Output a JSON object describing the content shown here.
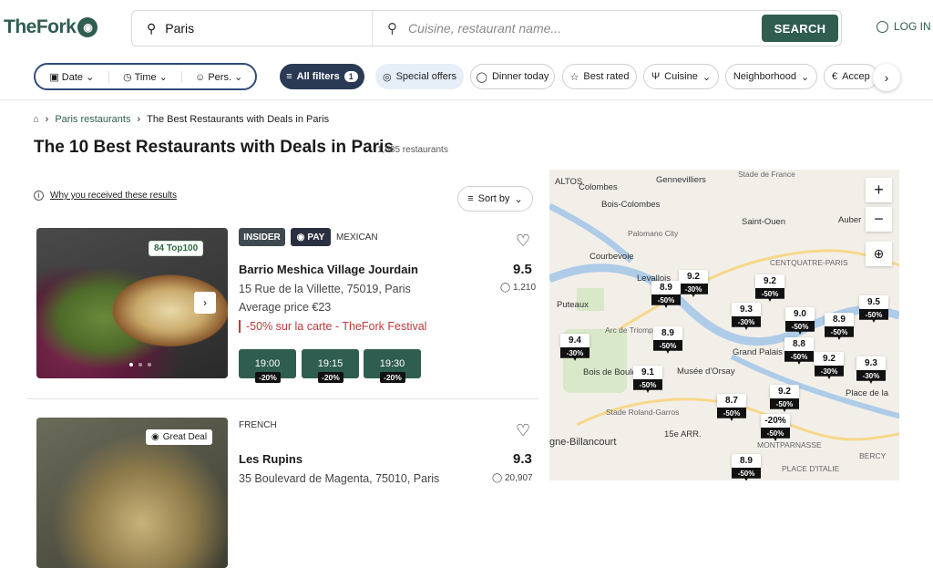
{
  "header": {
    "logo": "TheFork",
    "location": "Paris",
    "search_placeholder": "Cuisine, restaurant name...",
    "search_button": "SEARCH",
    "login": "LOG IN"
  },
  "filters": {
    "date": "Date",
    "time": "Time",
    "pers": "Pers.",
    "all_filters": "All filters",
    "all_filters_count": "1",
    "chips": [
      "Special offers",
      "Dinner today",
      "Best rated",
      "Cuisine",
      "Neighborhood",
      "Accep"
    ]
  },
  "breadcrumb": [
    "Paris restaurants",
    "The Best Restaurants with Deals in Paris"
  ],
  "title": "The 10 Best Restaurants with Deals in Paris",
  "result_count": "1,685 restaurants",
  "why_results": "Why you received these results",
  "sort_label": "Sort by",
  "restaurants": [
    {
      "badge": "84 Top100",
      "tags": [
        "INSIDER",
        "PAY"
      ],
      "cuisine": "MEXICAN",
      "name": "Barrio Meshica Village Jourdain",
      "rating": "9.5",
      "reviews": "1,210",
      "address": "15 Rue de la Villette, 75019, Paris",
      "price": "Average price €23",
      "offer": "-50% sur la carte - TheFork Festival",
      "slots": [
        {
          "time": "19:00",
          "discount": "-20%"
        },
        {
          "time": "19:15",
          "discount": "-20%"
        },
        {
          "time": "19:30",
          "discount": "-20%"
        }
      ]
    },
    {
      "badge": "Great Deal",
      "cuisine": "FRENCH",
      "name": "Les Rupins",
      "rating": "9.3",
      "reviews": "20,907",
      "address": "35 Boulevard de Magenta, 75010, Paris"
    }
  ],
  "map": {
    "labels": [
      "Colombes",
      "Gennevilliers",
      "Bois-Colombes",
      "Stade de France",
      "Saint-Ouen",
      "Auber",
      "Palomano City",
      "Courbevoie",
      "Levallois",
      "CENTQUATRE-PARIS",
      "Puteaux",
      "Arc de Triomphe",
      "Grand Palais",
      "Musée d'Orsay",
      "Bois de Boulogne",
      "Stade Roland-Garros",
      "15e ARR.",
      "gne-Billancourt",
      "MONTPARNASSE",
      "PLACE D'ITALIE",
      "Place de la",
      "BERCY",
      "ALTOS"
    ],
    "pins": [
      {
        "score": "9.2",
        "discount": "-30%"
      },
      {
        "score": "8.9",
        "discount": "-50%"
      },
      {
        "score": "9.2",
        "discount": "-50%"
      },
      {
        "score": "9.5",
        "discount": "-50%"
      },
      {
        "score": "9.3",
        "discount": "-30%"
      },
      {
        "score": "9.0",
        "discount": "-50%"
      },
      {
        "score": "8.9",
        "discount": "-50%"
      },
      {
        "score": "8.9",
        "discount": "-50%"
      },
      {
        "score": "8.8",
        "discount": "-50%"
      },
      {
        "score": "9.4",
        "discount": "-30%"
      },
      {
        "score": "9.1",
        "discount": "-50%"
      },
      {
        "score": "9.2",
        "discount": "-50%"
      },
      {
        "score": "9.3",
        "discount": "-30%"
      },
      {
        "score": "9.2",
        "discount": "-30%"
      },
      {
        "score": "8.7",
        "discount": "-50%"
      },
      {
        "score": "-20%",
        "discount": "-50%"
      },
      {
        "score": "8.9",
        "discount": "-50%"
      }
    ]
  }
}
